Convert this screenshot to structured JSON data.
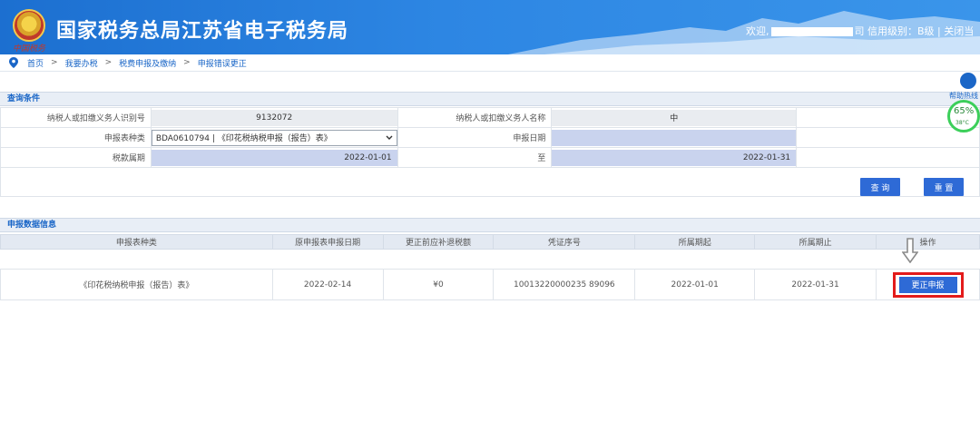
{
  "header": {
    "emblem_caption": "中国税务",
    "title": "国家税务总局江苏省电子税务局",
    "welcome": "欢迎,",
    "welcome_tail": "司",
    "credit_label": "信用级别：B级",
    "separator": "|",
    "close_label": "关闭当"
  },
  "breadcrumb": {
    "items": [
      "首页",
      "我要办税",
      "税费申报及缴纳",
      "申报错误更正"
    ],
    "separator": ">"
  },
  "query": {
    "section_title": "查询条件",
    "taxpayer_id_label": "纳税人或扣缴义务人识别号",
    "taxpayer_id_value": "9132072",
    "taxpayer_name_label": "纳税人或扣缴义务人名称",
    "taxpayer_name_value": "中",
    "form_type_label": "申报表种类",
    "form_type_value": "BDA0610794 | 《印花税纳税申报（报告）表》",
    "report_date_label": "申报日期",
    "report_date_value": "",
    "period_label": "税款属期",
    "period_start": "2022-01-01",
    "period_to_label": "至",
    "period_end": "2022-01-31",
    "search_button": "查 询",
    "reset_button": "重 置"
  },
  "results": {
    "section_title": "申报数据信息",
    "columns": [
      "申报表种类",
      "原申报表申报日期",
      "更正前应补退税额",
      "凭证序号",
      "所属期起",
      "所属期止",
      "操作"
    ],
    "rows": [
      {
        "form": "《印花税纳税申报（报告）表》",
        "orig_date": "2022-02-14",
        "amount": "¥0",
        "voucher": "10013220000235 89096",
        "start": "2022-01-01",
        "end": "2022-01-31",
        "action": "更正申报"
      }
    ]
  },
  "widget": {
    "cs_label": "帮助热线",
    "percent": "65%",
    "temp": "38°C"
  },
  "colors": {
    "header_blue": "#1c6fd0",
    "button_blue": "#2e6ad6",
    "highlight_red": "#e31b1b",
    "input_fill": "#c9d3ee"
  }
}
